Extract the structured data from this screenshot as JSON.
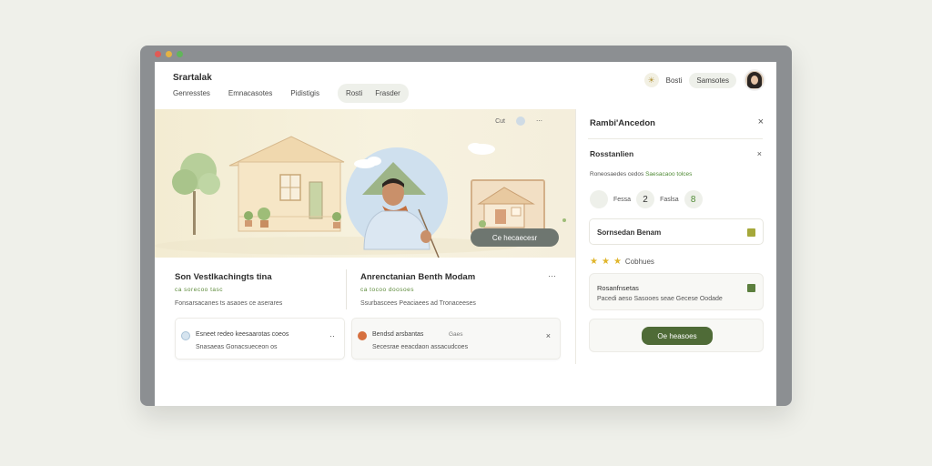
{
  "window": {
    "traffic_lights": [
      "#e15a55",
      "#e4b344",
      "#61b55a"
    ]
  },
  "header": {
    "brand": "Srartalak",
    "nav": [
      "Genresstes",
      "Emnacasotes",
      "Pidistigis"
    ],
    "pill_tabs": [
      "Rosti",
      "Frasder"
    ],
    "right_icon": "sun-icon",
    "right_text": "Bosti",
    "right_pill": "Samsotes"
  },
  "hero": {
    "corner_text": "Cut",
    "button": "Ce hecaecesr"
  },
  "card_left": {
    "title": "Son Vestlkachingts tina",
    "subtitle": "ca sorecoo tasc",
    "line": "Fonsarsacanes ts asaoes ce aserares"
  },
  "card_right": {
    "title": "Anrenctanian Benth Modam",
    "subtitle": "ca tocoo doosoes",
    "line": "Ssurbascees Peaciaees ad Tronaceeses",
    "more": "···"
  },
  "subcard_left": {
    "line1": "Esneet redeo keesaarotas coeos",
    "line2": "Snasaeas Gonacsueceon os",
    "action": "··"
  },
  "subcard_right": {
    "line1": "Bendsd arsbantas",
    "badge": "Gaes",
    "line2": "Secesrae eeacdaon assacudcoes",
    "action": "×"
  },
  "right_panel": {
    "title": "Rambi'Ancedon",
    "close": "×",
    "section": "Rosstanlien",
    "caret": "×",
    "tags_plain": "Roneosaedes cedos",
    "tags_green": "Saesacaoo tolces",
    "steps": [
      {
        "num": "",
        "label": "Fessa"
      },
      {
        "num": "2",
        "label": "Faslsa"
      },
      {
        "num": "8",
        "label": ""
      }
    ],
    "box_label": "Sornsedan Benam",
    "stars_count": 3,
    "stars_label": "Cobhues",
    "card_title": "Rosanfnsetas",
    "card_line": "Pacedi aeso Sasooes seae Gecese Oodade",
    "cta": "Oe heasoes"
  }
}
